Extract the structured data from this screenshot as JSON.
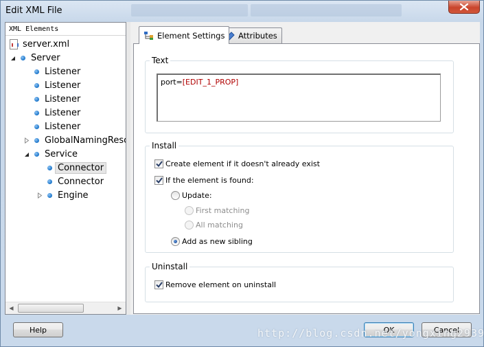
{
  "window": {
    "title": "Edit XML File"
  },
  "tree": {
    "header": "XML Elements",
    "items": [
      {
        "label": "server.xml",
        "level": 0,
        "type": "file"
      },
      {
        "label": "Server",
        "level": 0,
        "expander": "expanded"
      },
      {
        "label": "Listener",
        "level": 1
      },
      {
        "label": "Listener",
        "level": 1
      },
      {
        "label": "Listener",
        "level": 1
      },
      {
        "label": "Listener",
        "level": 1
      },
      {
        "label": "Listener",
        "level": 1
      },
      {
        "label": "GlobalNamingResc",
        "level": 1,
        "expander": "collapsed"
      },
      {
        "label": "Service",
        "level": 1,
        "expander": "expanded"
      },
      {
        "label": "Connector",
        "level": 2,
        "selected": true
      },
      {
        "label": "Connector",
        "level": 2
      },
      {
        "label": "Engine",
        "level": 2,
        "expander": "collapsed"
      }
    ]
  },
  "tabs": [
    {
      "label": "Element Settings",
      "active": true,
      "icon": "element-settings-icon"
    },
    {
      "label": "Attributes",
      "active": false,
      "icon": "attributes-icon"
    }
  ],
  "text_group": {
    "title": "Text",
    "value_prefix": "port=",
    "value_prop": "[EDIT_1_PROP]"
  },
  "install_group": {
    "title": "Install",
    "create_element": {
      "label": "Create element if it doesn't already exist",
      "checked": true
    },
    "if_found": {
      "label": "If the element is found:",
      "checked": true
    },
    "update": {
      "label": "Update:",
      "selected": false
    },
    "first_matching": {
      "label": "First matching",
      "disabled": true
    },
    "all_matching": {
      "label": "All matching",
      "disabled": true
    },
    "add_sibling": {
      "label": "Add as new sibling",
      "selected": true
    }
  },
  "uninstall_group": {
    "title": "Uninstall",
    "remove_element": {
      "label": "Remove element on uninstall",
      "checked": true
    }
  },
  "buttons": {
    "help": "Help",
    "ok": "OK",
    "cancel": "Cancel"
  },
  "watermark": "http://blog.csdn.net/yongxing2939",
  "colors": {
    "accent": "#1a74c9",
    "prop_text": "#b00000",
    "close": "#c9452c"
  }
}
